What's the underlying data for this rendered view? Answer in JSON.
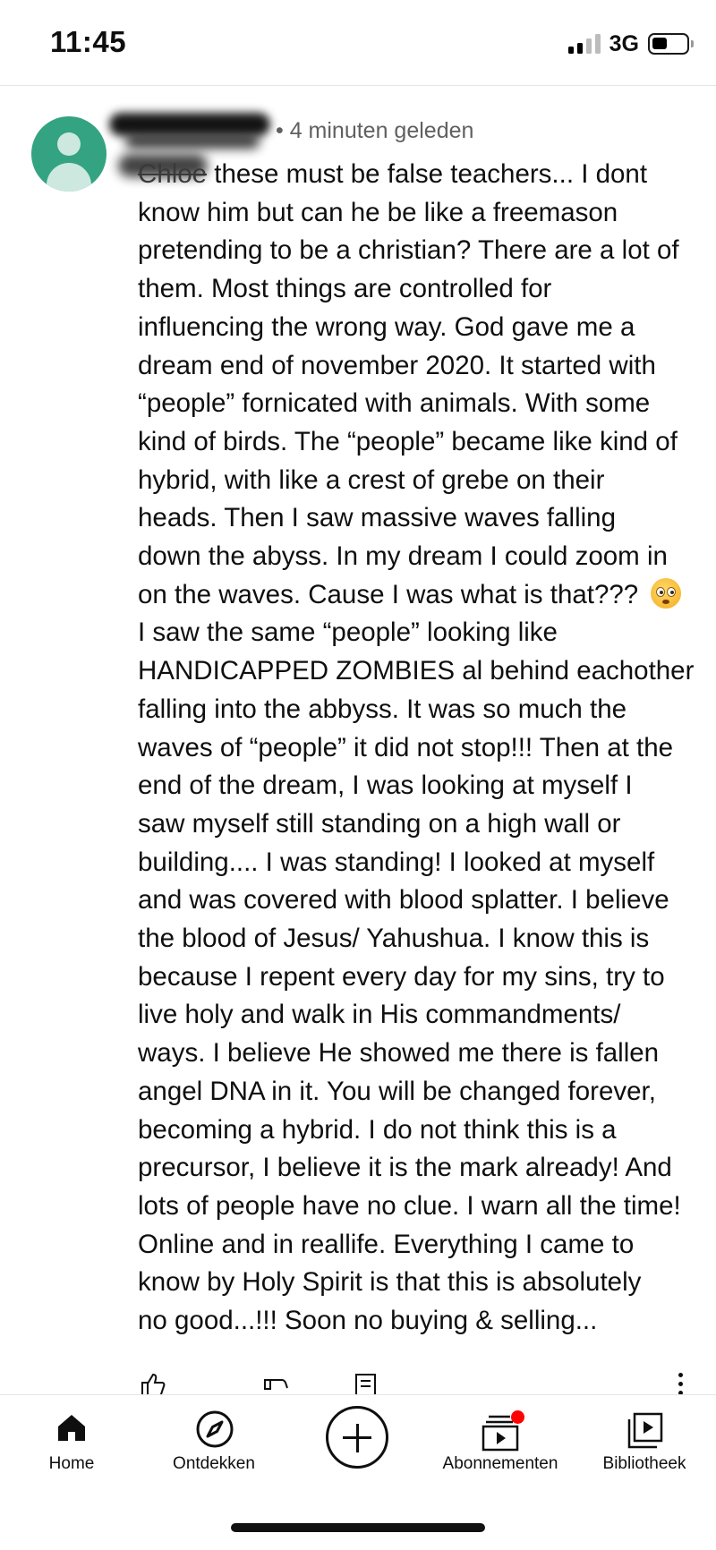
{
  "status_bar": {
    "time": "11:45",
    "network": "3G",
    "signal_bars_active": 2,
    "signal_bars_total": 4,
    "battery_level": 0.35
  },
  "comment": {
    "author_redacted": true,
    "meta": "• 4 minuten geleden",
    "mention": "Chloe",
    "lines": [
      " these must be false teachers... I dont",
      "know him but can he be like a freemason",
      "pretending to be a christian? There are a lot of",
      "them. Most things are controlled for",
      "influencing the wrong way. God gave me a",
      "dream end of november 2020. It started with",
      "“people” fornicated with animals. With some",
      "kind of birds. The “people” became like kind of",
      "hybrid, with like a crest of grebe on their",
      "heads. Then I saw massive waves falling",
      "down the abyss. In my dream I could zoom in",
      "on the waves. Cause I was what is that??? ",
      "I saw the same “people” looking like",
      "HANDICAPPED ZOMBIES al behind eachother",
      "falling into the abbyss. It was so much the",
      "waves of “people” it did not stop!!! Then at the",
      "end of the dream, I was looking at myself I",
      "saw myself still standing on a high wall or",
      "building.... I was standing! I looked at myself",
      "and was covered with blood splatter. I believe",
      "the blood of Jesus/ Yahushua. I know this is",
      "because I repent every day for my sins, try to",
      "live holy and walk in His commandments/",
      "ways. I believe He showed me there is fallen",
      "angel DNA in it. You will be changed forever,",
      "becoming a hybrid. I do not think this is a",
      "precursor, I believe it is the mark already! And",
      "lots of people have no clue. I warn all the time!",
      "Online and in reallife. Everything I came to",
      "know by Holy Spirit is that this is absolutely",
      "no good...!!! Soon no buying & selling..."
    ],
    "emoji_icon": "flushed-face-emoji"
  },
  "actions": {
    "icons": [
      "thumbs-up-icon",
      "thumbs-down-icon",
      "reply-icon",
      "more-vert-icon"
    ]
  },
  "bottom_nav": {
    "items": [
      {
        "label": "Home",
        "icon": "home-icon",
        "active": true
      },
      {
        "label": "Ontdekken",
        "icon": "explore-icon"
      },
      {
        "label": "",
        "icon": "create-plus-icon"
      },
      {
        "label": "Abonnementen",
        "icon": "subscriptions-icon",
        "has_badge": true
      },
      {
        "label": "Bibliotheek",
        "icon": "library-icon"
      }
    ],
    "badge_color": "#ff0000"
  },
  "colors": {
    "avatar": "#34a382",
    "meta_text": "#606060",
    "text": "#0f0f0f"
  }
}
